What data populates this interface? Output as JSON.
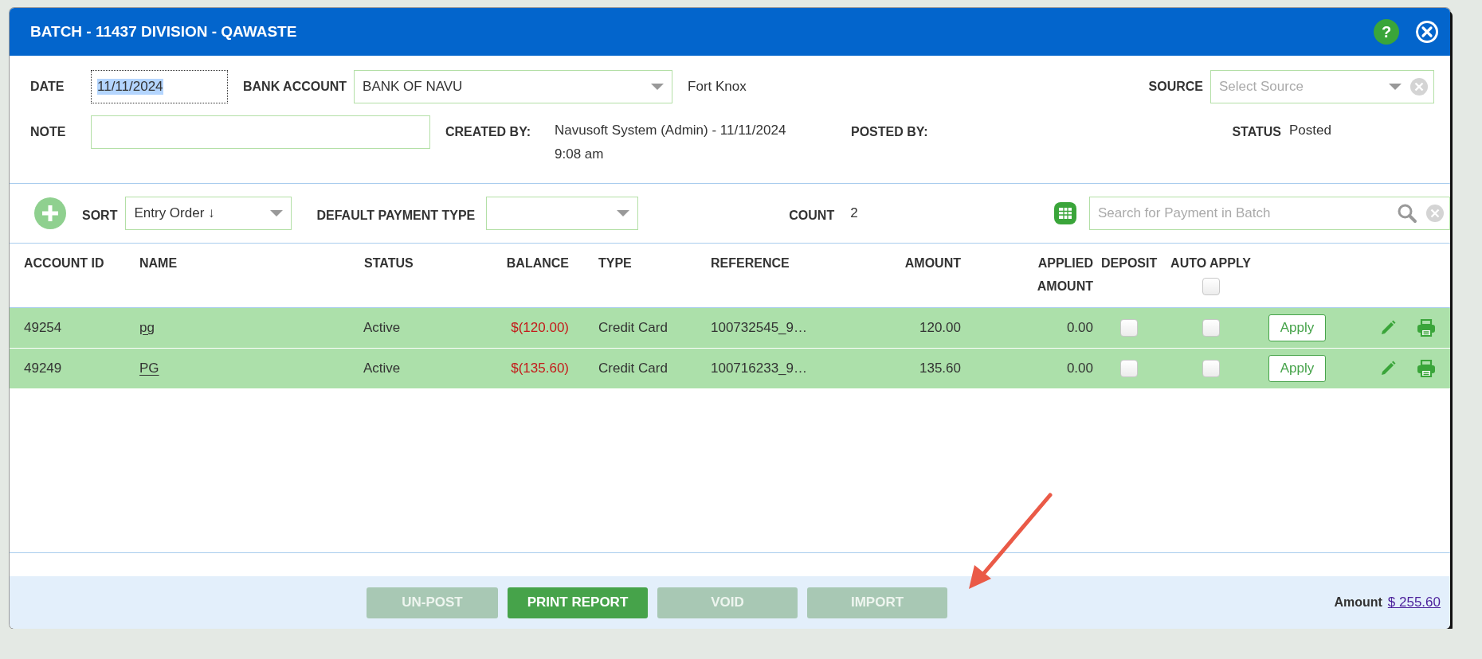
{
  "window": {
    "title": "BATCH - 11437 DIVISION - QAWASTE",
    "help_button": "?"
  },
  "header": {
    "date": {
      "label": "DATE",
      "value": "11/11/2024",
      "text_selected": true
    },
    "bank_account": {
      "label": "BANK ACCOUNT",
      "value": "BANK OF NAVU",
      "note": "Fort Knox"
    },
    "source": {
      "label": "SOURCE",
      "placeholder": "Select Source"
    },
    "note": {
      "label": "NOTE"
    },
    "created_by": {
      "label": "CREATED BY:",
      "value": "Navusoft System (Admin) - 11/11/2024 9:08 am"
    },
    "posted_by": {
      "label": "POSTED BY:"
    },
    "status": {
      "label": "STATUS",
      "value": "Posted"
    }
  },
  "toolbar": {
    "sort": {
      "label": "SORT",
      "value": "Entry Order ↓"
    },
    "default_payment_type": {
      "label": "DEFAULT PAYMENT TYPE"
    },
    "count": {
      "label": "COUNT",
      "value": "2"
    },
    "search": {
      "placeholder": "Search for Payment in Batch"
    }
  },
  "table": {
    "columns": [
      "ACCOUNT ID",
      "NAME",
      "STATUS",
      "BALANCE",
      "TYPE",
      "REFERENCE",
      "AMOUNT",
      "APPLIED AMOUNT",
      "DEPOSIT",
      "AUTO APPLY"
    ],
    "auto_apply_all": {
      "checked": false
    },
    "rows": [
      {
        "account_id": "49254",
        "name": "pg",
        "status": "Active",
        "balance": "$(120.00)",
        "type": "Credit Card",
        "reference": "100732545_9…",
        "amount": "120.00",
        "applied_amount": "0.00",
        "deposit": false,
        "auto_apply": false,
        "action": "Apply",
        "selected": true
      },
      {
        "account_id": "49249",
        "name": "PG",
        "status": "Active",
        "balance": "$(135.60)",
        "type": "Credit Card",
        "reference": "100716233_9…",
        "amount": "135.60",
        "applied_amount": "0.00",
        "deposit": false,
        "auto_apply": false,
        "action": "Apply",
        "selected": true
      }
    ]
  },
  "footer": {
    "buttons": [
      {
        "label": "UN-POST",
        "disabled": true
      },
      {
        "label": "PRINT REPORT",
        "disabled": false
      },
      {
        "label": "VOID",
        "disabled": true
      },
      {
        "label": "IMPORT",
        "disabled": true
      }
    ],
    "total": {
      "label": "Amount",
      "value": "$ 255.60"
    }
  }
}
